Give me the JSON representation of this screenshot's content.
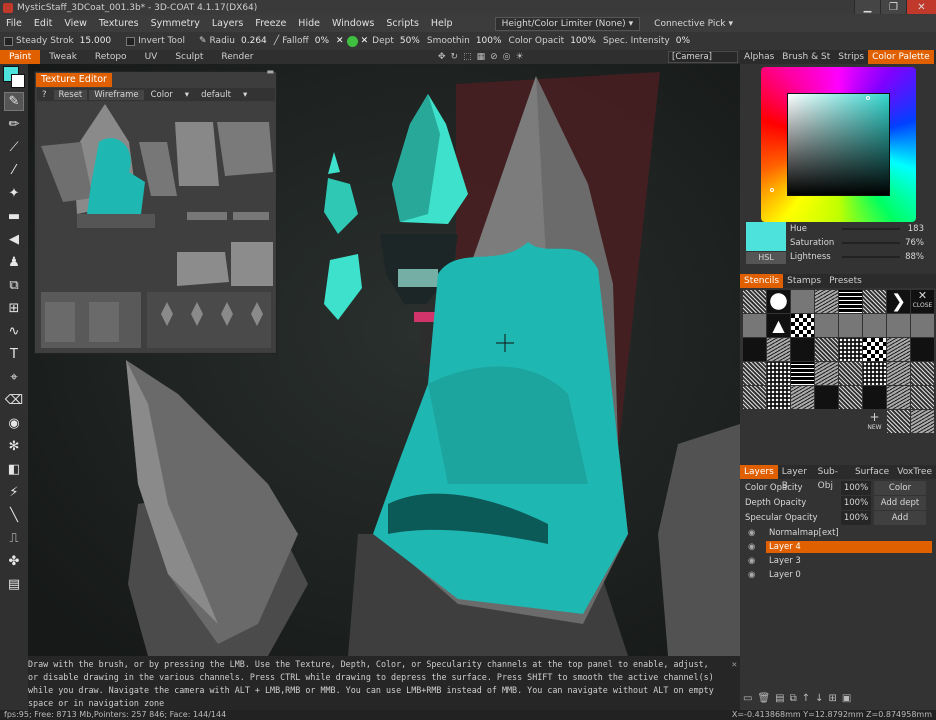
{
  "window": {
    "title": "MysticStaff_3DCoat_001.3b* - 3D-COAT 4.1.17(DX64)",
    "minimize": "▁",
    "restore": "❐",
    "close": "✕"
  },
  "menubar": {
    "items": [
      "File",
      "Edit",
      "View",
      "Textures",
      "Symmetry",
      "Layers",
      "Freeze",
      "Hide",
      "Windows",
      "Scripts",
      "Help"
    ],
    "height_limiter": "Height/Color Limiter (None)",
    "connective_pick": "Connective Pick"
  },
  "tool_options": {
    "steady_stroke_label": "Steady Strok",
    "steady_stroke_value": "15.000",
    "invert_tool_label": "Invert Tool",
    "radius_label": "Radiu",
    "radius_value": "0.264",
    "falloff_label": "Falloff",
    "falloff_value": "0%",
    "depth_label": "Dept",
    "depth_value": "50%",
    "smoothing_label": "Smoothin",
    "smoothing_value": "100%",
    "color_opacity_label": "Color Opacit",
    "color_opacity_value": "100%",
    "spec_intensity_label": "Spec. Intensity",
    "spec_intensity_value": "0%"
  },
  "rooms": [
    "Paint",
    "Tweak",
    "Retopo",
    "UV",
    "Sculpt",
    "Render"
  ],
  "active_room": "Paint",
  "camera_label": "[Camera]",
  "texture_editor": {
    "title": "Texture Editor",
    "help": "?",
    "reset": "Reset",
    "wireframe": "Wireframe",
    "channel": "Color",
    "preset": "default"
  },
  "right_panel": {
    "tabs": [
      "Alphas",
      "Brush & St",
      "Strips",
      "Color Palette"
    ],
    "active_tab": "Color Palette",
    "color": {
      "current_hex": "#4ee2dc",
      "hue_label": "Hue",
      "hue_value": "183",
      "saturation_label": "Saturation",
      "saturation_value": "76%",
      "lightness_label": "Lightness",
      "lightness_value": "88%",
      "mode_button": "HSL"
    },
    "stencil_tabs": [
      "Stencils",
      "Stamps",
      "Presets"
    ],
    "stencil_close": "CLOSE",
    "stencil_new": "NEW",
    "layers_tabs": [
      "Layers",
      "Layer B",
      "Sub-Obj",
      "Surface",
      "VoxTree"
    ],
    "layer_props": [
      {
        "label": "Color Opacity",
        "value": "100%",
        "mode": "Color"
      },
      {
        "label": "Depth Opacity",
        "value": "100%",
        "mode": "Add dept"
      },
      {
        "label": "Specular Opacity",
        "value": "100%",
        "mode": "Add"
      }
    ],
    "layers": [
      "Normalmap[ext]",
      "Layer 4",
      "Layer 3",
      "Layer 0"
    ],
    "active_layer": "Layer 4"
  },
  "hint": "Draw with the brush, or by pressing the LMB. Use the Texture, Depth, Color, or Specularity channels at the top panel to enable, adjust, or disable drawing in the various channels. Press CTRL while drawing to depress the surface. Press SHIFT to smooth the active channel(s) while you draw. Navigate the camera with ALT + LMB,RMB or MMB. You can use LMB+RMB instead of MMB. You can navigate without ALT on empty space or in navigation zone",
  "status": {
    "left": "fps:95;   Free: 8713 Mb,Pointers: 257 846; Face: 144/144",
    "right": "X=-0.413868mm  Y=12.8792mm  Z=0.874958mm"
  }
}
